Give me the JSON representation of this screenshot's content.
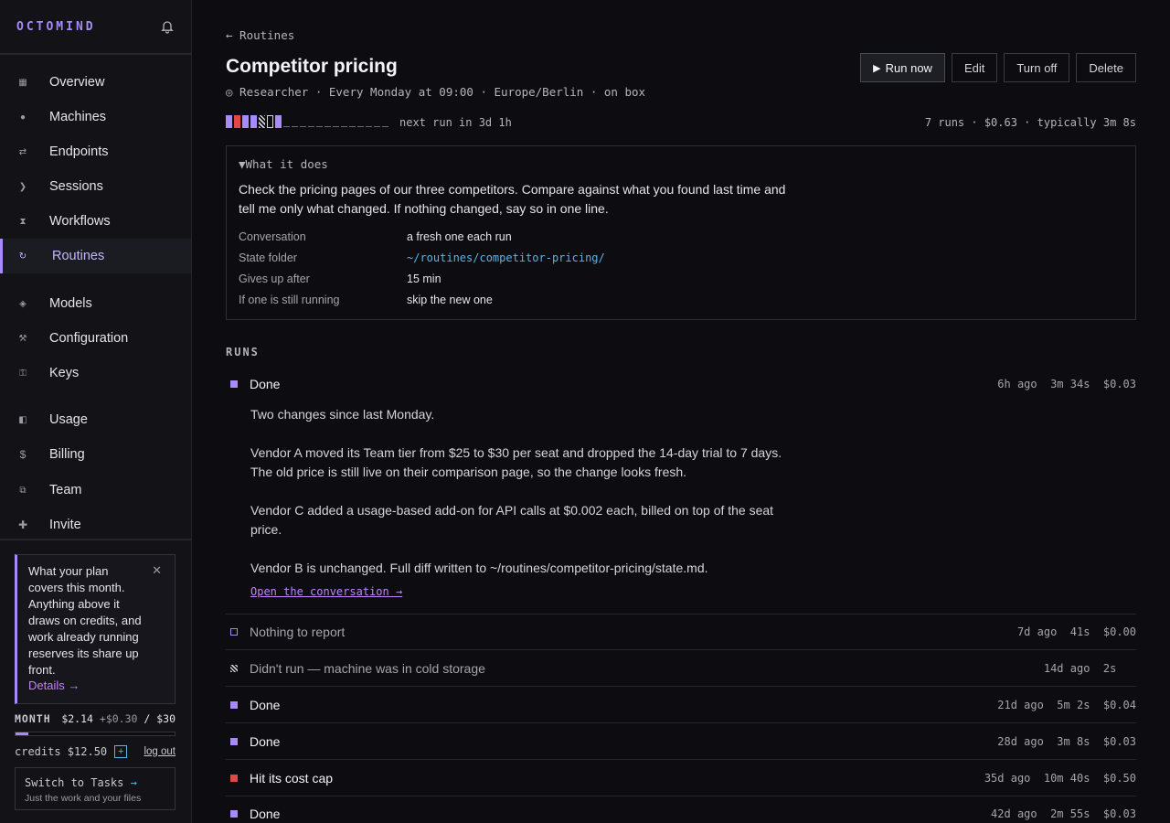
{
  "app": {
    "brand": "OCTOMIND"
  },
  "sidebar": {
    "items": [
      {
        "label": "Overview",
        "icon": "grid-icon"
      },
      {
        "label": "Machines",
        "icon": "dot-icon"
      },
      {
        "label": "Endpoints",
        "icon": "arrows-icon"
      },
      {
        "label": "Sessions",
        "icon": "chevron-right-icon"
      },
      {
        "label": "Workflows",
        "icon": "hourglass-icon"
      },
      {
        "label": "Routines",
        "icon": "refresh-icon",
        "active": true
      },
      {
        "label": "Models",
        "icon": "diamond-icon"
      },
      {
        "label": "Configuration",
        "icon": "tools-icon"
      },
      {
        "label": "Keys",
        "icon": "key-icon"
      },
      {
        "label": "Usage",
        "icon": "half-square-icon"
      },
      {
        "label": "Billing",
        "icon": "dollar-icon"
      },
      {
        "label": "Team",
        "icon": "team-icon"
      },
      {
        "label": "Invite",
        "icon": "plus-icon"
      }
    ],
    "tip": {
      "text": "What your plan covers this month. Anything above it draws on credits, and work already running reserves its share up front.",
      "link": "Details →",
      "close": "✕"
    },
    "month": {
      "label": "MONTH",
      "used": "$2.14",
      "reserved": "+$0.30",
      "limit": "/ $30",
      "fill_fraction": 0.08
    },
    "credits": {
      "text": "credits $12.50",
      "add": "+",
      "logout": "log out"
    },
    "switch": {
      "title": "Switch to Tasks",
      "arrow": "→",
      "sub": "Just the work and your files"
    }
  },
  "page": {
    "back": "← Routines",
    "title": "Competitor pricing",
    "subtitle": "◎ Researcher · Every Monday at 09:00 · Europe/Berlin · on box",
    "actions": {
      "run_now": "Run now",
      "edit": "Edit",
      "turn_off": "Turn off",
      "delete": "Delete"
    },
    "next_run": "next run in 3d 1h",
    "stats": "7 runs  · $0.63  · typically 3m 8s",
    "strip_colors": [
      "#a78bfa",
      "#e04848",
      "#a78bfa",
      "#a78bfa",
      "hatch",
      "outline",
      "#a78bfa"
    ]
  },
  "what": {
    "head": "▼What it does",
    "desc": "Check the pricing pages of our three competitors. Compare against what you found last time and tell me only what changed. If nothing changed, say so in one line.",
    "rows": [
      {
        "key": "Conversation",
        "val": "a fresh one each run"
      },
      {
        "key": "State folder",
        "val": "~/routines/competitor-pricing/"
      },
      {
        "key": "Gives up after",
        "val": "15 min"
      },
      {
        "key": "If one is still running",
        "val": "skip the new one"
      }
    ]
  },
  "runs": {
    "head": "RUNS",
    "items": [
      {
        "status": "Done",
        "meta": "6h ago  3m 34s  $0.03",
        "kind": "done"
      },
      {
        "status": "Nothing to report",
        "meta": "7d ago  41s  $0.00",
        "kind": "empty"
      },
      {
        "status": "Didn't run — machine was in cold storage",
        "meta": "14d ago  2s   ",
        "kind": "skipped"
      },
      {
        "status": "Done",
        "meta": "21d ago  5m 2s  $0.04",
        "kind": "done"
      },
      {
        "status": "Done",
        "meta": "28d ago  3m 8s  $0.03",
        "kind": "done"
      },
      {
        "status": "Hit its cost cap",
        "meta": "35d ago  10m 40s  $0.50",
        "kind": "cap"
      },
      {
        "status": "Done",
        "meta": "42d ago  2m 55s  $0.03",
        "kind": "done"
      }
    ],
    "expanded": {
      "p1": "Two changes since last Monday.",
      "p2": "Vendor A moved its Team tier from $25 to $30 per seat and dropped the 14-day trial to 7 days. The old price is still live on their comparison page, so the change looks fresh.",
      "p3": "Vendor C added a usage-based add-on for API calls at $0.002 each, billed on top of the seat price.",
      "p4": "Vendor B is unchanged. Full diff written to ~/routines/competitor-pricing/state.md.",
      "link": "Open the conversation →"
    }
  },
  "colors": {
    "accent": "#a78bfa",
    "danger": "#e04848",
    "link": "#5ab4e8"
  }
}
